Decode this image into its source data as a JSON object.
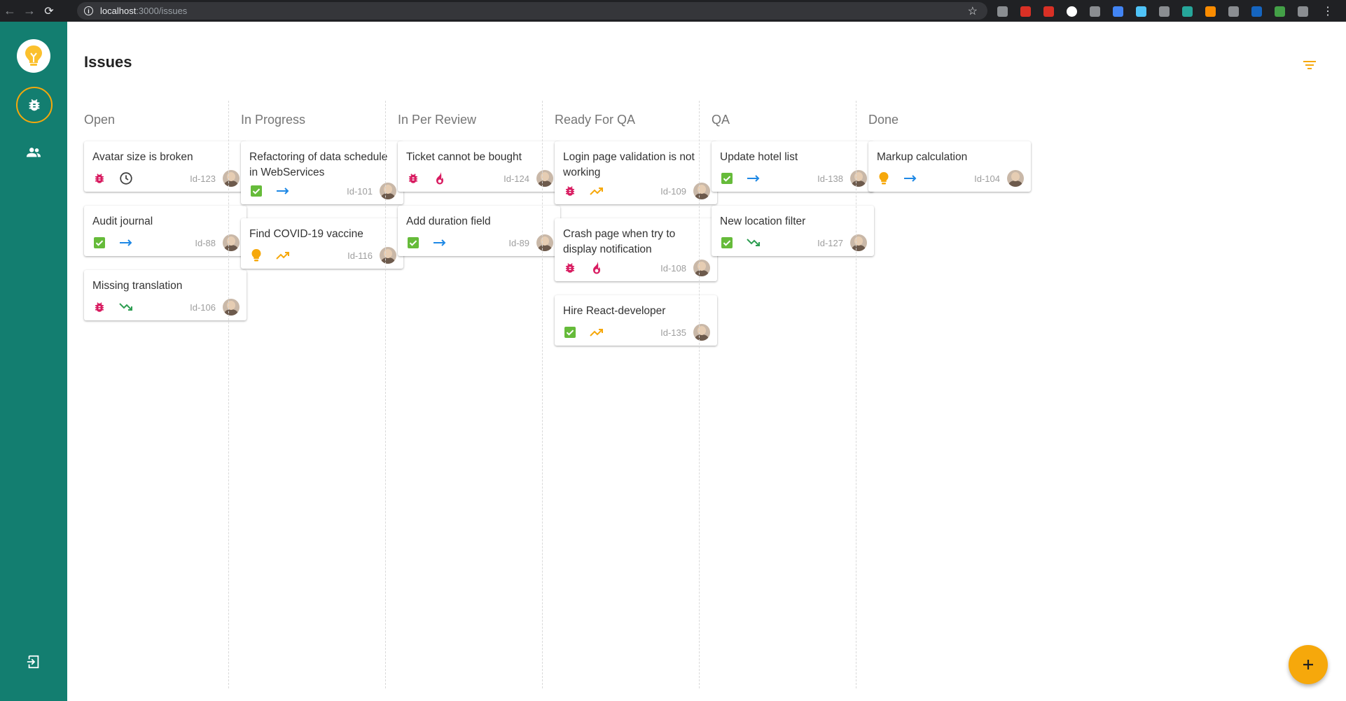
{
  "browser": {
    "url_host": "localhost",
    "url_path": ":3000/issues",
    "extension_colors": [
      "#8a8d91",
      "#d93025",
      "#d93025",
      "#ffffff",
      "#8a8d91",
      "#4285f4",
      "#4fc3f7",
      "#8a8d91",
      "#26a69a",
      "#fb8c00",
      "#8a8d91",
      "#1565c0",
      "#43a047",
      "#8a8d91"
    ]
  },
  "page": {
    "title": "Issues"
  },
  "colors": {
    "sidebar": "#137e70",
    "accent": "#f6a80b",
    "bug": "#d81b60",
    "story": "#66bb3a",
    "arrow_blue": "#1e88e5",
    "trend_up": "#f6a80b",
    "trend_down": "#2e9e52",
    "fire": "#d81b60"
  },
  "columns": [
    {
      "title": "Open",
      "cards": [
        {
          "title": "Avatar size is broken",
          "type": "bug-icon",
          "priority": "clock-icon",
          "id": "Id-123"
        },
        {
          "title": "Audit journal",
          "type": "check-icon",
          "priority": "arrow-right-icon",
          "id": "Id-88"
        },
        {
          "title": "Missing translation",
          "type": "bug-icon",
          "priority": "trending-down-icon",
          "id": "Id-106"
        }
      ]
    },
    {
      "title": "In Progress",
      "cards": [
        {
          "title": "Refactoring of data schedule in WebServices",
          "type": "check-icon",
          "priority": "arrow-right-icon",
          "id": "Id-101"
        },
        {
          "title": "Find COVID-19 vaccine",
          "type": "bulb-icon",
          "priority": "trending-up-icon",
          "id": "Id-116"
        }
      ]
    },
    {
      "title": "In Per Review",
      "cards": [
        {
          "title": "Ticket cannot be bought",
          "type": "bug-icon",
          "priority": "fire-icon",
          "id": "Id-124"
        },
        {
          "title": "Add duration field",
          "type": "check-icon",
          "priority": "arrow-right-icon",
          "id": "Id-89"
        }
      ]
    },
    {
      "title": "Ready For QA",
      "cards": [
        {
          "title": "Login page validation is not working",
          "type": "bug-icon",
          "priority": "trending-up-icon",
          "id": "Id-109"
        },
        {
          "title": "Crash page when try to display notification",
          "type": "bug-icon",
          "priority": "fire-icon",
          "id": "Id-108"
        },
        {
          "title": "Hire React-developer",
          "type": "check-icon",
          "priority": "trending-up-icon",
          "id": "Id-135"
        }
      ]
    },
    {
      "title": "QA",
      "cards": [
        {
          "title": "Update hotel list",
          "type": "check-icon",
          "priority": "arrow-right-icon",
          "id": "Id-138"
        },
        {
          "title": "New location filter",
          "type": "check-icon",
          "priority": "trending-down-icon",
          "id": "Id-127"
        }
      ]
    },
    {
      "title": "Done",
      "cards": [
        {
          "title": "Markup calculation",
          "type": "bulb-icon",
          "priority": "arrow-right-icon",
          "id": "Id-104"
        }
      ]
    }
  ]
}
